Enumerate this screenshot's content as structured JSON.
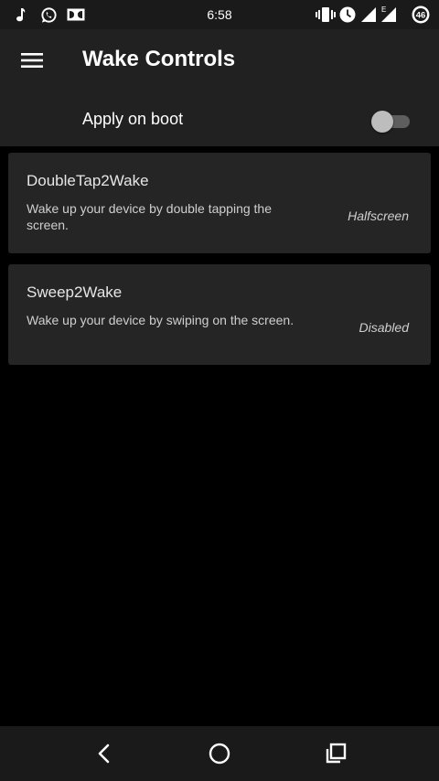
{
  "status_bar": {
    "time": "6:58",
    "network_type": "E",
    "battery_level": "46",
    "left_icons": [
      "music-note-icon",
      "whatsapp-icon",
      "dolby-icon"
    ],
    "right_icons": [
      "vibrate-icon",
      "alarm-clock-icon",
      "signal-icon",
      "mobile-data-signal-icon",
      "battery-icon"
    ]
  },
  "app_bar": {
    "title": "Wake Controls",
    "menu_icon": "hamburger-menu-icon",
    "apply_on_boot": {
      "label": "Apply on boot",
      "enabled": false
    }
  },
  "cards": [
    {
      "title": "DoubleTap2Wake",
      "description": "Wake up your device by double tapping the screen.",
      "value": "Halfscreen"
    },
    {
      "title": "Sweep2Wake",
      "description": "Wake up your device by swiping on the screen.",
      "value": "Disabled"
    }
  ],
  "nav_bar": {
    "icons": [
      "back-icon",
      "home-icon",
      "recents-icon"
    ]
  },
  "colors": {
    "status_bar": "#1a1a1a",
    "app_bar": "#212121",
    "card": "#252525",
    "background": "#000000",
    "switch_thumb_off": "#bdbdbd",
    "switch_track_off": "#5e5e5e"
  }
}
